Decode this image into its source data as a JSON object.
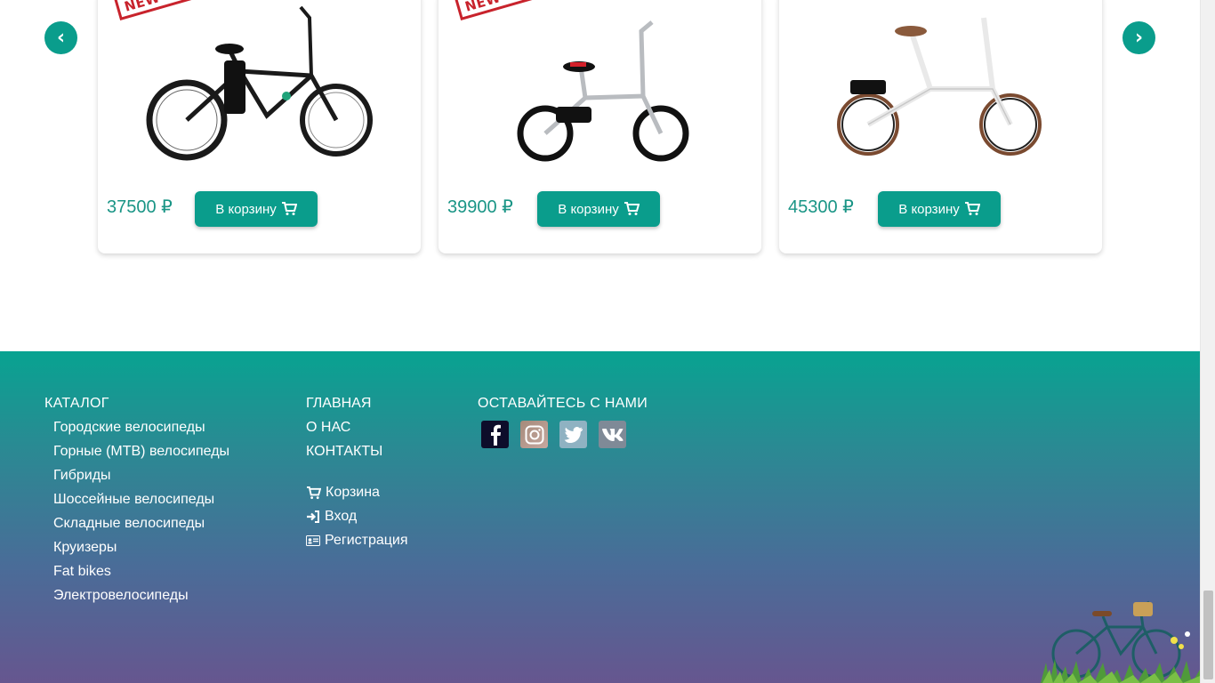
{
  "carousel": {
    "prev_label": "‹",
    "next_label": "›"
  },
  "products": [
    {
      "badge": "NEW PRODUCT",
      "price": "37500 ₽",
      "button": "В корзину"
    },
    {
      "badge": "NEW PRODUCT",
      "price": "39900 ₽",
      "button": "В корзину"
    },
    {
      "badge": "",
      "price": "45300 ₽",
      "button": "В корзину"
    }
  ],
  "footer": {
    "catalog": {
      "title": "КАТАЛОГ",
      "items": [
        "Городские велосипеды",
        "Горные (MTB) велосипеды",
        "Гибриды",
        "Шоссейные велосипеды",
        "Складные велосипеды",
        "Круизеры",
        "Fat bikes",
        "Электровелосипеды"
      ]
    },
    "nav": {
      "items": [
        "ГЛАВНАЯ",
        "О НАС",
        "КОНТАКТЫ"
      ],
      "cart": "Корзина",
      "login": "Вход",
      "register": "Регистрация"
    },
    "social": {
      "title": "ОСТАВАЙТЕСЬ С НАМИ"
    }
  },
  "colors": {
    "accent": "#0a9d8c",
    "badge_red": "#c8232c",
    "footer_top": "#08a391",
    "footer_bottom": "#66568f"
  }
}
